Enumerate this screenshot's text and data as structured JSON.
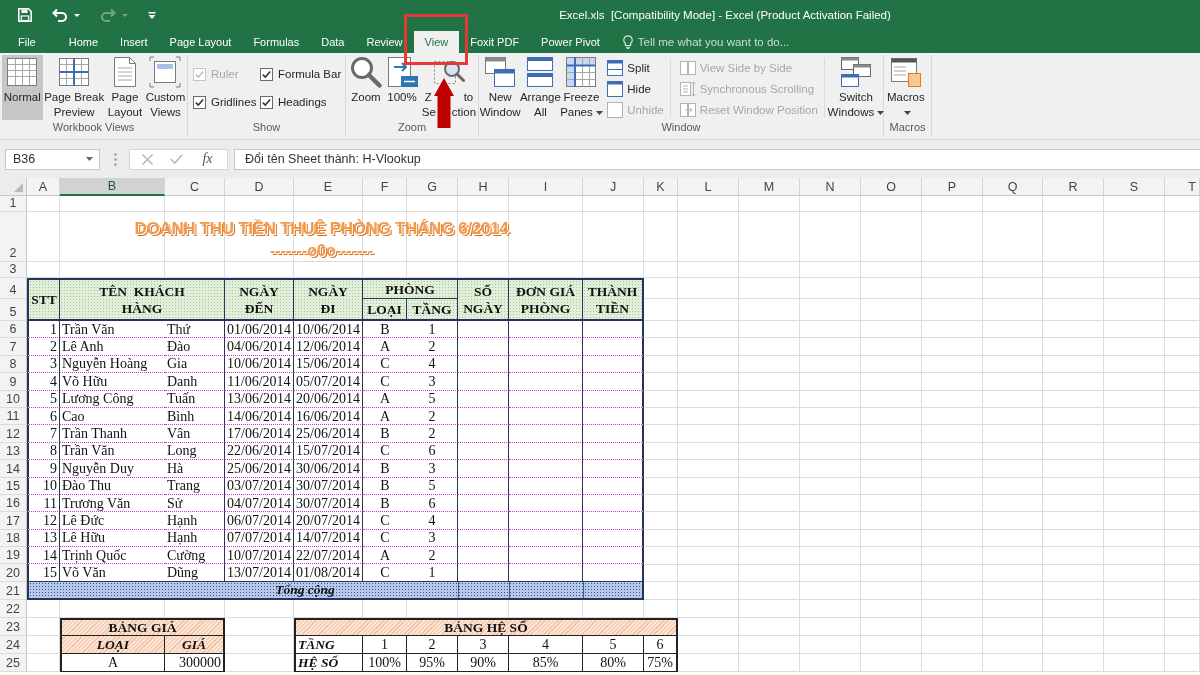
{
  "window": {
    "title": "Excel.xls  [Compatibility Mode] - Excel (Product Activation Failed)"
  },
  "quick_access": [
    {
      "kind": "save",
      "dropdown": false,
      "disabled": false
    },
    {
      "kind": "undo",
      "dropdown": true,
      "disabled": false
    },
    {
      "kind": "redo",
      "dropdown": true,
      "disabled": true
    },
    {
      "kind": "customize",
      "dropdown": false,
      "disabled": false
    }
  ],
  "tabs": [
    {
      "label": "File",
      "selected": false
    },
    {
      "label": "Home",
      "selected": false
    },
    {
      "label": "Insert",
      "selected": false
    },
    {
      "label": "Page Layout",
      "selected": false
    },
    {
      "label": "Formulas",
      "selected": false
    },
    {
      "label": "Data",
      "selected": false
    },
    {
      "label": "Review",
      "selected": false
    },
    {
      "label": "View",
      "selected": true
    },
    {
      "label": "Foxit PDF",
      "selected": false
    },
    {
      "label": "Power Pivot",
      "selected": false
    }
  ],
  "tell_me": {
    "placeholder": "Tell me what you want to do..."
  },
  "ribbon": {
    "workbook_views": {
      "label": "Workbook Views",
      "views": [
        {
          "label": "Normal",
          "selected": true
        },
        {
          "label": "Page Break\nPreview",
          "selected": false
        },
        {
          "label": "Page\nLayout",
          "selected": false
        }
      ],
      "custom_views": {
        "label": "Custom\nViews"
      }
    },
    "show": {
      "label": "Show",
      "options": [
        {
          "label": "Ruler",
          "checked": true,
          "disabled": true
        },
        {
          "label": "Formula Bar",
          "checked": true,
          "disabled": false
        },
        {
          "label": "Gridlines",
          "checked": true,
          "disabled": false
        },
        {
          "label": "Headings",
          "checked": true,
          "disabled": false
        }
      ]
    },
    "zoom": {
      "label": "Zoom",
      "buttons": [
        {
          "label": "Zoom"
        },
        {
          "label": "100%"
        },
        {
          "label": "Z          to\nSe     ction"
        }
      ]
    },
    "window": {
      "label": "Window",
      "buttons": [
        {
          "label": "New\nWindow",
          "dropdown": false
        },
        {
          "label": "Arrange\nAll",
          "dropdown": false
        },
        {
          "label": "Freeze\nPanes",
          "dropdown": true
        }
      ],
      "commands": [
        {
          "label": "Split",
          "disabled": false
        },
        {
          "label": "Hide",
          "disabled": false
        },
        {
          "label": "Unhide",
          "disabled": true
        }
      ],
      "compare": [
        {
          "label": "View Side by Side",
          "disabled": true
        },
        {
          "label": "Synchronous Scrolling",
          "disabled": true
        },
        {
          "label": "Reset Window Position",
          "disabled": true
        }
      ],
      "switch": {
        "label": "Switch\nWindows",
        "dropdown": true
      }
    },
    "macros": {
      "label": "Macros",
      "button": {
        "label": "Macros",
        "dropdown": true
      }
    }
  },
  "formula_bar": {
    "name_box": "B36",
    "function_label": "fx",
    "formula": "Đổi tên Sheet thành: H-Vlookup"
  },
  "sheet": {
    "columns": [
      {
        "label": "A",
        "selected": false
      },
      {
        "label": "B",
        "selected": true
      },
      {
        "label": "C",
        "selected": false
      },
      {
        "label": "D",
        "selected": false
      },
      {
        "label": "E",
        "selected": false
      },
      {
        "label": "F",
        "selected": false
      },
      {
        "label": "G",
        "selected": false
      },
      {
        "label": "H",
        "selected": false
      },
      {
        "label": "I",
        "selected": false
      },
      {
        "label": "J",
        "selected": false
      },
      {
        "label": "K",
        "selected": false
      },
      {
        "label": "L",
        "selected": false
      },
      {
        "label": "M",
        "selected": false
      },
      {
        "label": "N",
        "selected": false
      },
      {
        "label": "O",
        "selected": false
      },
      {
        "label": "P",
        "selected": false
      },
      {
        "label": "Q",
        "selected": false
      },
      {
        "label": "R",
        "selected": false
      },
      {
        "label": "S",
        "selected": false
      },
      {
        "label": "T",
        "selected": false
      }
    ],
    "row_headers": [
      "1",
      "2",
      "3",
      "4",
      "5",
      "6",
      "7",
      "8",
      "9",
      "10",
      "11",
      "12",
      "13",
      "14",
      "15",
      "16",
      "17",
      "18",
      "19",
      "20",
      "21",
      "22",
      "23",
      "24",
      "25"
    ],
    "title": "DOANH THU TIỀN THUÊ PHÒNG THÁNG 6/2014",
    "ornament": "-------o0o-------",
    "table": {
      "header": {
        "stt": "STT",
        "customer": "TÊN  KHÁCH\nHÀNG",
        "arrival": "NGÀY\nĐẾN",
        "departure": "NGÀY\nĐI",
        "room": "PHÒNG",
        "room_type": "LOẠI",
        "floor": "TẦNG",
        "days": "SỐ\nNGÀY",
        "unit_price": "ĐƠN GIÁ\nPHÒNG",
        "amount": "THÀNH\nTIỀN"
      },
      "rows": [
        {
          "stt": "1",
          "surname": "Trần Văn",
          "given_name": "Thứ",
          "arrival": "01/06/2014",
          "departure": "10/06/2014",
          "room_type": "B",
          "floor": "1"
        },
        {
          "stt": "2",
          "surname": "Lê Anh",
          "given_name": "Đào",
          "arrival": "04/06/2014",
          "departure": "12/06/2014",
          "room_type": "A",
          "floor": "2"
        },
        {
          "stt": "3",
          "surname": "Nguyễn Hoàng",
          "given_name": "Gia",
          "arrival": "10/06/2014",
          "departure": "15/06/2014",
          "room_type": "C",
          "floor": "4"
        },
        {
          "stt": "4",
          "surname": "Võ Hữu",
          "given_name": "Danh",
          "arrival": "11/06/2014",
          "departure": "05/07/2014",
          "room_type": "C",
          "floor": "3"
        },
        {
          "stt": "5",
          "surname": "Lương Công",
          "given_name": "Tuấn",
          "arrival": "13/06/2014",
          "departure": "20/06/2014",
          "room_type": "A",
          "floor": "5"
        },
        {
          "stt": "6",
          "surname": "Cao",
          "given_name": "Bình",
          "arrival": "14/06/2014",
          "departure": "16/06/2014",
          "room_type": "A",
          "floor": "2"
        },
        {
          "stt": "7",
          "surname": "Trần Thanh",
          "given_name": "Vân",
          "arrival": "17/06/2014",
          "departure": "25/06/2014",
          "room_type": "B",
          "floor": "2"
        },
        {
          "stt": "8",
          "surname": "Trần Văn",
          "given_name": "Long",
          "arrival": "22/06/2014",
          "departure": "15/07/2014",
          "room_type": "C",
          "floor": "6"
        },
        {
          "stt": "9",
          "surname": "Nguyễn Duy",
          "given_name": "Hà",
          "arrival": "25/06/2014",
          "departure": "30/06/2014",
          "room_type": "B",
          "floor": "3"
        },
        {
          "stt": "10",
          "surname": "Đào Thu",
          "given_name": "Trang",
          "arrival": "03/07/2014",
          "departure": "30/07/2014",
          "room_type": "B",
          "floor": "5"
        },
        {
          "stt": "11",
          "surname": "Trương Văn",
          "given_name": "Sử",
          "arrival": "04/07/2014",
          "departure": "30/07/2014",
          "room_type": "B",
          "floor": "6"
        },
        {
          "stt": "12",
          "surname": "Lê Đức",
          "given_name": "Hạnh",
          "arrival": "06/07/2014",
          "departure": "20/07/2014",
          "room_type": "C",
          "floor": "4"
        },
        {
          "stt": "13",
          "surname": "Lê Hữu",
          "given_name": "Hạnh",
          "arrival": "07/07/2014",
          "departure": "14/07/2014",
          "room_type": "C",
          "floor": "3"
        },
        {
          "stt": "14",
          "surname": "Trịnh Quốc",
          "given_name": "Cường",
          "arrival": "10/07/2014",
          "departure": "22/07/2014",
          "room_type": "A",
          "floor": "2"
        },
        {
          "stt": "15",
          "surname": "Võ Văn",
          "given_name": "Dũng",
          "arrival": "13/07/2014",
          "departure": "01/08/2014",
          "room_type": "C",
          "floor": "1"
        }
      ],
      "total": "Tổng cộng"
    },
    "price_table": {
      "title": "BẢNG GIÁ",
      "columns": [
        "LOẠI",
        "GIÁ"
      ],
      "rows": [
        [
          "A",
          "300000"
        ]
      ]
    },
    "coefficient_table": {
      "title": "BẢNG HỆ SỐ",
      "rows": [
        {
          "label": "TẦNG",
          "values": [
            "1",
            "2",
            "3",
            "4",
            "5",
            "6"
          ]
        },
        {
          "label": "HỆ SỐ",
          "values": [
            "100%",
            "95%",
            "90%",
            "85%",
            "80%",
            "75%"
          ]
        }
      ]
    }
  }
}
